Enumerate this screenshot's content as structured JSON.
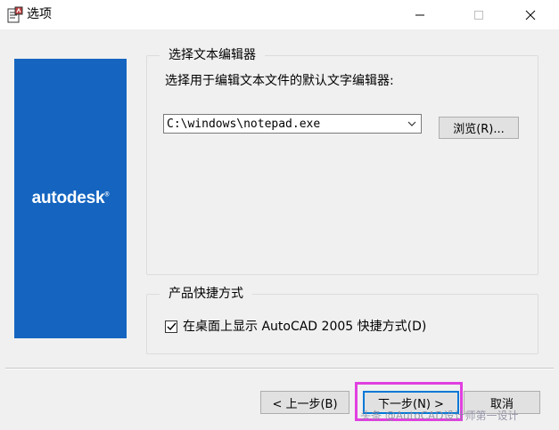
{
  "window": {
    "title": "选项",
    "icon": "autocad-app-icon"
  },
  "logo": {
    "text": "autodesk",
    "registered": "®",
    "bg_color": "#1565c0"
  },
  "editor_group": {
    "legend": "选择文本编辑器",
    "description": "选择用于编辑文本文件的默认文字编辑器:",
    "editor_value": "C:\\windows\\notepad.exe",
    "browse_label": "浏览(R)..."
  },
  "shortcut_group": {
    "legend": "产品快捷方式",
    "checkbox_checked": true,
    "checkbox_label": "在桌面上显示 AutoCAD 2005 快捷方式(D)"
  },
  "buttons": {
    "back_label": "< 上一步(B)",
    "next_label": "下一步(N) >",
    "cancel_label": "取消"
  },
  "highlight_color": "#e040e0",
  "watermark": "头条 @AutoCAD设计师第一设计"
}
